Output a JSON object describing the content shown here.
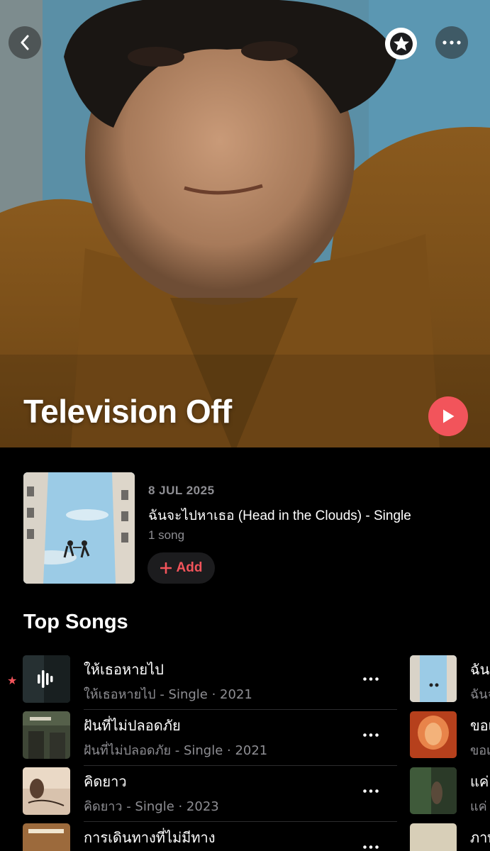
{
  "artist": {
    "name": "Television Off"
  },
  "latest_release": {
    "date": "8 JUL 2025",
    "title": "ฉันจะไปหาเธอ (Head in the Clouds) - Single",
    "count": "1 song",
    "add_label": "Add"
  },
  "top_songs": {
    "heading": "Top Songs",
    "items": [
      {
        "title": "ให้เธอหายไป",
        "subtitle": "ให้เธอหายไป - Single · 2021",
        "favorite": true,
        "now_playing": true
      },
      {
        "title": "ฝันที่ไม่ปลอดภัย",
        "subtitle": "ฝันที่ไม่ปลอดภัย - Single · 2021"
      },
      {
        "title": "คิดยาว",
        "subtitle": "คิดยาว - Single · 2023"
      },
      {
        "title": "การเดินทางที่ไม่มีทาง",
        "subtitle": ""
      }
    ],
    "second_column": [
      {
        "title": "ฉันจ",
        "subtitle": "ฉันจ"
      },
      {
        "title": "ขอเ",
        "subtitle": "ขอเ"
      },
      {
        "title": "แค่",
        "subtitle": "แค่"
      },
      {
        "title": "ภาพ",
        "subtitle": ""
      }
    ]
  },
  "icons": {
    "back": "chevron-left-icon",
    "star": "star-icon",
    "more": "ellipsis-icon",
    "play": "play-icon",
    "add": "plus-icon",
    "playing": "waveform-icon"
  },
  "colors": {
    "accent": "#f2545b",
    "background": "#000000",
    "secondary_text": "#8e8e93"
  }
}
